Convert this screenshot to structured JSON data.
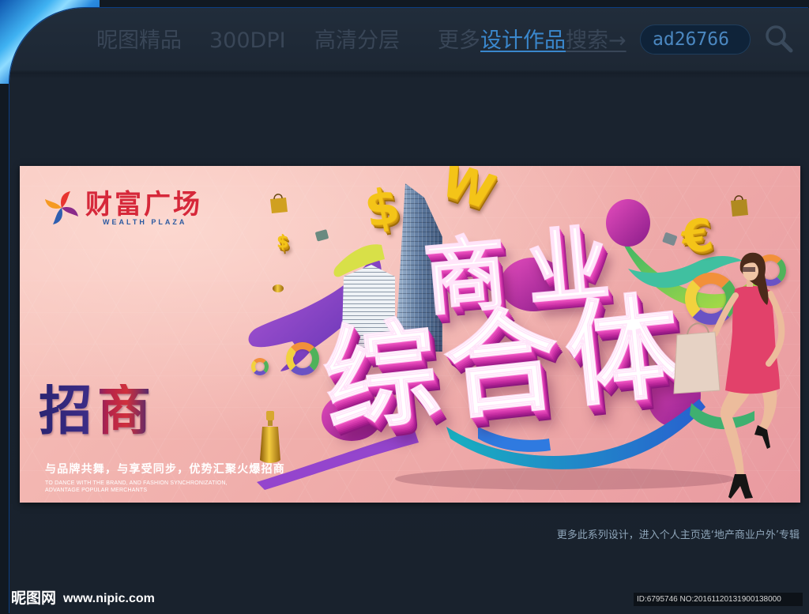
{
  "header": {
    "nav": [
      {
        "label": "昵图精品"
      },
      {
        "label": "300DPI"
      },
      {
        "label": "高清分层"
      }
    ],
    "more_prefix": "更多",
    "more_link": "设计作品",
    "more_suffix": "搜索→",
    "search_value": "ad26766"
  },
  "icons": {
    "search": "search-icon",
    "logo": "wealth-plaza-logo-icon"
  },
  "banner": {
    "logo_name": "财富广场",
    "logo_sub": "WEALTH PLAZA",
    "headline_1": "商业",
    "headline_2": "综合体",
    "recruit": "招商",
    "slogan_cn": "与品牌共舞，与享受同步，优势汇聚火爆招商",
    "slogan_en_1": "TO DANCE WITH THE BRAND, AND FASHION SYNCHRONIZATION,",
    "slogan_en_2": "ADVANTAGE POPULAR MERCHANTS",
    "currency_symbols": [
      "$",
      "W",
      "€",
      "$"
    ]
  },
  "series_note": "更多此系列设计，进入个人主页选‘地产商业户外’专辑",
  "footer": {
    "brand": "昵图网",
    "url": "www.nipic.com",
    "image_id": "ID:6795746 NO:20161120131900138000"
  },
  "colors": {
    "accent": "#3a87cc",
    "nav_gray": "#394657",
    "banner_pink": "#f0aeab",
    "logo_red": "#d6283a",
    "headline_extrusion": "#c62ea2"
  }
}
